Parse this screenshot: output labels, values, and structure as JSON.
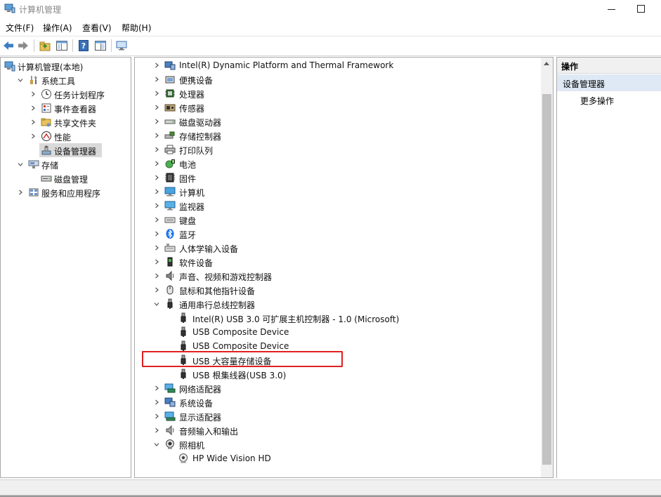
{
  "window": {
    "title": "计算机管理",
    "icon": "computer-management-icon"
  },
  "menu": [
    "文件(F)",
    "操作(A)",
    "查看(V)",
    "帮助(H)"
  ],
  "toolbar": [
    {
      "name": "back-button",
      "icon": "arrow-left-icon"
    },
    {
      "name": "forward-button",
      "icon": "arrow-right-icon"
    },
    {
      "name": "up-folder-button",
      "icon": "folder-up-icon"
    },
    {
      "name": "show-hide-tree-button",
      "icon": "console-tree-icon"
    },
    {
      "name": "help-button",
      "icon": "help-book-icon"
    },
    {
      "name": "properties-button",
      "icon": "properties-panel-icon"
    },
    {
      "name": "monitor-button",
      "icon": "monitor-icon"
    }
  ],
  "tree": [
    {
      "label": "计算机管理(本地)",
      "icon": "computer-management-icon",
      "level": 0,
      "expander": "none"
    },
    {
      "label": "系统工具",
      "icon": "tools-icon",
      "level": 1,
      "expander": "down"
    },
    {
      "label": "任务计划程序",
      "icon": "clock-icon",
      "level": 2,
      "expander": "right"
    },
    {
      "label": "事件查看器",
      "icon": "event-viewer-icon",
      "level": 2,
      "expander": "right"
    },
    {
      "label": "共享文件夹",
      "icon": "shared-folder-icon",
      "level": 2,
      "expander": "right"
    },
    {
      "label": "性能",
      "icon": "performance-icon",
      "level": 2,
      "expander": "right"
    },
    {
      "label": "设备管理器",
      "icon": "device-manager-icon",
      "level": 2,
      "expander": "none",
      "selected": true
    },
    {
      "label": "存储",
      "icon": "storage-icon",
      "level": 1,
      "expander": "down"
    },
    {
      "label": "磁盘管理",
      "icon": "disk-management-icon",
      "level": 2,
      "expander": "none"
    },
    {
      "label": "服务和应用程序",
      "icon": "services-icon",
      "level": 1,
      "expander": "right"
    }
  ],
  "devices": [
    {
      "label": "Intel(R) Dynamic Platform and Thermal Framework",
      "icon": "platform-icon",
      "level": 0,
      "expander": "right"
    },
    {
      "label": "便携设备",
      "icon": "portable-device-icon",
      "level": 0,
      "expander": "right"
    },
    {
      "label": "处理器",
      "icon": "processor-icon",
      "level": 0,
      "expander": "right"
    },
    {
      "label": "传感器",
      "icon": "sensor-icon",
      "level": 0,
      "expander": "right"
    },
    {
      "label": "磁盘驱动器",
      "icon": "disk-drive-icon",
      "level": 0,
      "expander": "right"
    },
    {
      "label": "存储控制器",
      "icon": "storage-controller-icon",
      "level": 0,
      "expander": "right"
    },
    {
      "label": "打印队列",
      "icon": "printer-icon",
      "level": 0,
      "expander": "right"
    },
    {
      "label": "电池",
      "icon": "battery-icon",
      "level": 0,
      "expander": "right"
    },
    {
      "label": "固件",
      "icon": "firmware-icon",
      "level": 0,
      "expander": "right"
    },
    {
      "label": "计算机",
      "icon": "computer-icon",
      "level": 0,
      "expander": "right"
    },
    {
      "label": "监视器",
      "icon": "monitor-icon",
      "level": 0,
      "expander": "right"
    },
    {
      "label": "键盘",
      "icon": "keyboard-icon",
      "level": 0,
      "expander": "right"
    },
    {
      "label": "蓝牙",
      "icon": "bluetooth-icon",
      "level": 0,
      "expander": "right"
    },
    {
      "label": "人体学输入设备",
      "icon": "hid-icon",
      "level": 0,
      "expander": "right"
    },
    {
      "label": "软件设备",
      "icon": "software-device-icon",
      "level": 0,
      "expander": "right"
    },
    {
      "label": "声音、视频和游戏控制器",
      "icon": "speaker-icon",
      "level": 0,
      "expander": "right"
    },
    {
      "label": "鼠标和其他指针设备",
      "icon": "mouse-icon",
      "level": 0,
      "expander": "right"
    },
    {
      "label": "通用串行总线控制器",
      "icon": "usb-icon",
      "level": 0,
      "expander": "down"
    },
    {
      "label": "Intel(R) USB 3.0 可扩展主机控制器 - 1.0 (Microsoft)",
      "icon": "usb-icon",
      "level": 1,
      "expander": "none"
    },
    {
      "label": "USB Composite Device",
      "icon": "usb-icon",
      "level": 1,
      "expander": "none"
    },
    {
      "label": "USB Composite Device",
      "icon": "usb-icon",
      "level": 1,
      "expander": "none"
    },
    {
      "label": "USB 大容量存储设备",
      "icon": "usb-icon",
      "level": 1,
      "expander": "none",
      "highlighted": true
    },
    {
      "label": "USB 根集线器(USB 3.0)",
      "icon": "usb-icon",
      "level": 1,
      "expander": "none"
    },
    {
      "label": "网络适配器",
      "icon": "network-adapter-icon",
      "level": 0,
      "expander": "right"
    },
    {
      "label": "系统设备",
      "icon": "system-device-icon",
      "level": 0,
      "expander": "right"
    },
    {
      "label": "显示适配器",
      "icon": "display-adapter-icon",
      "level": 0,
      "expander": "right"
    },
    {
      "label": "音频输入和输出",
      "icon": "audio-io-icon",
      "level": 0,
      "expander": "right"
    },
    {
      "label": "照相机",
      "icon": "camera-icon",
      "level": 0,
      "expander": "down"
    },
    {
      "label": "HP Wide Vision HD",
      "icon": "webcam-icon",
      "level": 1,
      "expander": "none"
    }
  ],
  "actions": {
    "title": "操作",
    "section": "设备管理器",
    "more": "更多操作"
  },
  "colors": {
    "highlight": "#e02020",
    "selection": "#d9d9d9",
    "actions_header": "#dfe9f5"
  }
}
